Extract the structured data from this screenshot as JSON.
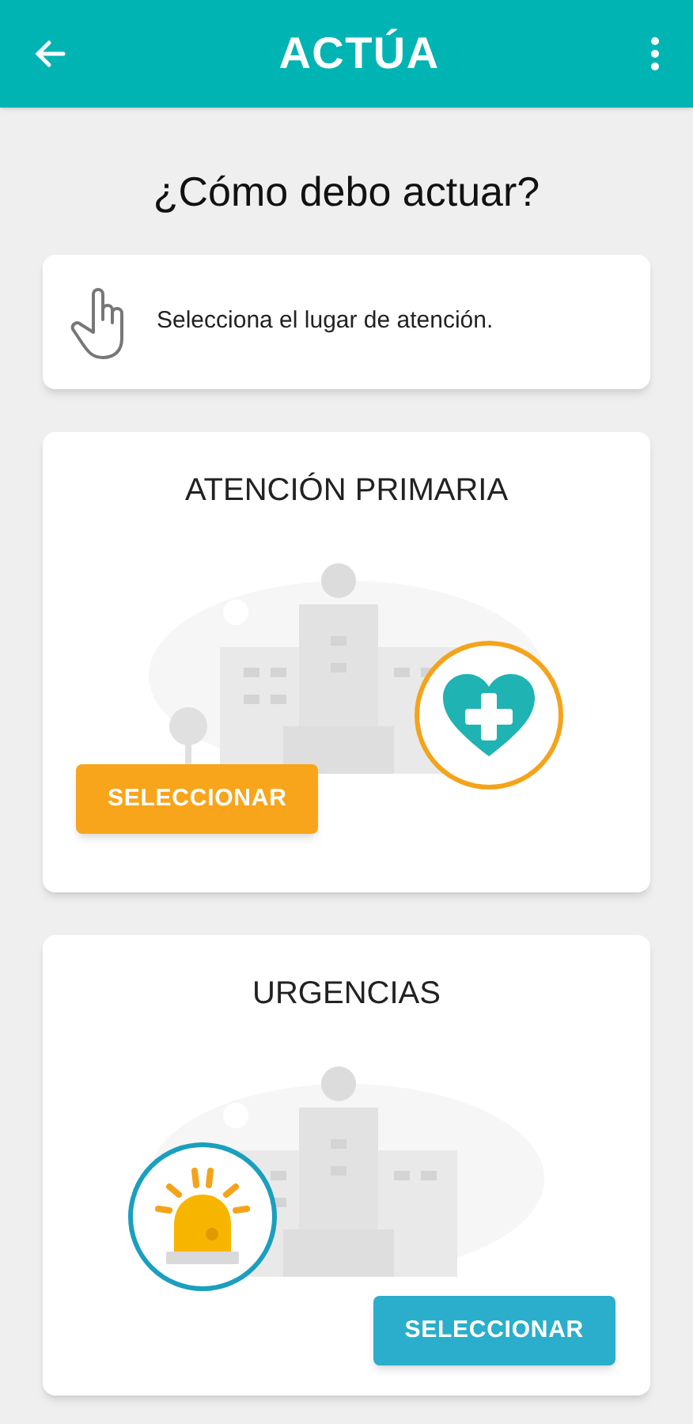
{
  "app_bar": {
    "title": "ACTÚA"
  },
  "heading": "¿Cómo debo actuar?",
  "instruction": "Selecciona el lugar de atención.",
  "options": [
    {
      "kind": "primary",
      "title": "ATENCIÓN PRIMARIA",
      "button": "SELECCIONAR"
    },
    {
      "kind": "urgent",
      "title": "URGENCIAS",
      "button": "SELECCIONAR"
    }
  ]
}
